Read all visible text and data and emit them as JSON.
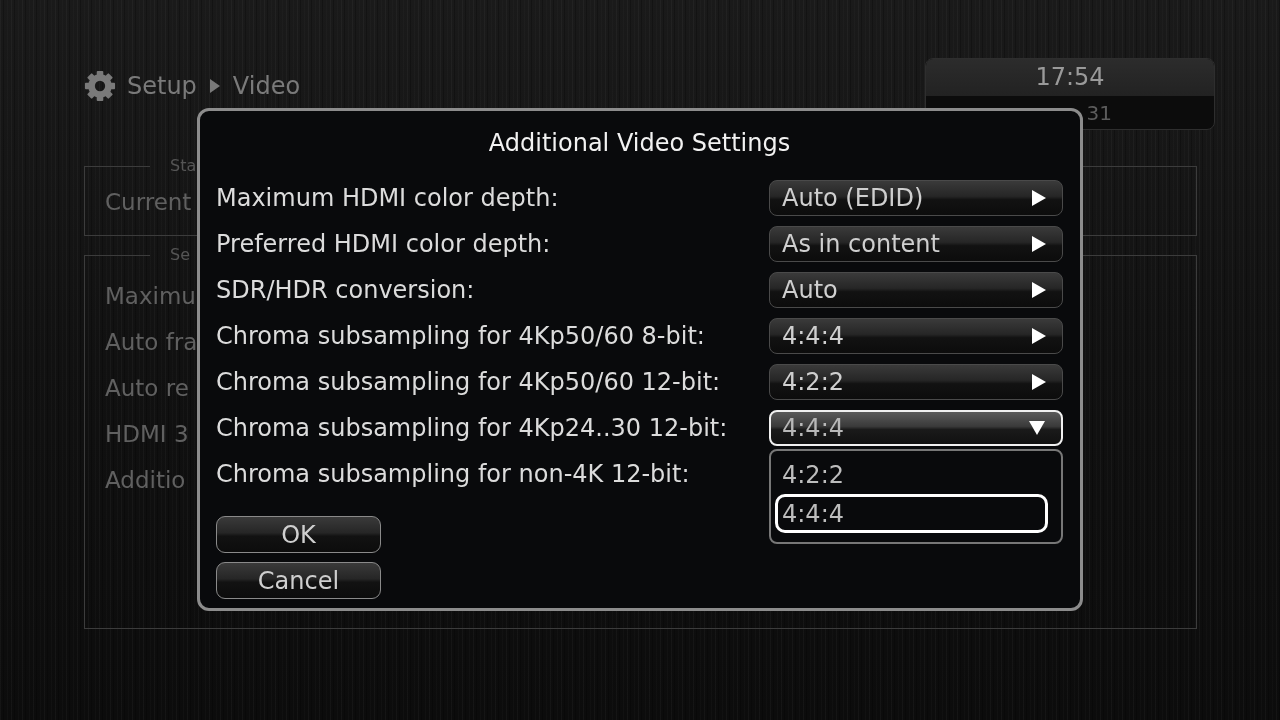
{
  "header": {
    "breadcrumb": [
      "Setup",
      "Video"
    ]
  },
  "clock": {
    "time": "17:54",
    "date": "31"
  },
  "background_panels": [
    {
      "legend": "Sta",
      "items": [
        "Current"
      ]
    },
    {
      "legend": "Se",
      "items": [
        "Maximu",
        "Auto fra",
        "Auto re",
        "HDMI 3",
        "Additio"
      ]
    }
  ],
  "dialog": {
    "title": "Additional Video Settings",
    "settings": [
      {
        "label": "Maximum HDMI color depth:",
        "value": "Auto (EDID)",
        "expanded": false
      },
      {
        "label": "Preferred HDMI color depth:",
        "value": "As in content",
        "expanded": false
      },
      {
        "label": "SDR/HDR conversion:",
        "value": "Auto",
        "expanded": false
      },
      {
        "label": "Chroma subsampling for 4Kp50/60 8-bit:",
        "value": "4:4:4",
        "expanded": false
      },
      {
        "label": "Chroma subsampling for 4Kp50/60 12-bit:",
        "value": "4:2:2",
        "expanded": false
      },
      {
        "label": "Chroma subsampling for 4Kp24..30 12-bit:",
        "value": "4:4:4",
        "expanded": true,
        "options": [
          {
            "label": "4:2:2",
            "selected": false
          },
          {
            "label": "4:4:4",
            "selected": true
          }
        ]
      },
      {
        "label": "Chroma subsampling for non-4K 12-bit:"
      }
    ],
    "buttons": [
      "OK",
      "Cancel"
    ]
  }
}
